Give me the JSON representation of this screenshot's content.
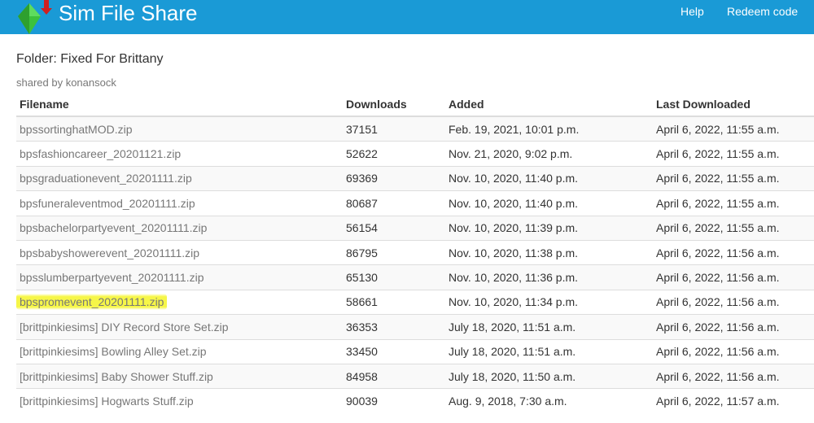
{
  "header": {
    "site_title": "Sim File Share",
    "nav": {
      "help": "Help",
      "redeem": "Redeem code"
    },
    "colors": {
      "bar": "#1a9ad6",
      "plumbob_green": "#3cc23c",
      "arrow_red": "#d02020"
    }
  },
  "folder": {
    "title": "Folder: Fixed For Brittany",
    "shared_by": "shared by konansock"
  },
  "table": {
    "headers": {
      "filename": "Filename",
      "downloads": "Downloads",
      "added": "Added",
      "last_downloaded": "Last Downloaded"
    },
    "rows": [
      {
        "filename": "bpssortinghatMOD.zip",
        "downloads": "37151",
        "added": "Feb. 19, 2021, 10:01 p.m.",
        "last_downloaded": "April 6, 2022, 11:55 a.m."
      },
      {
        "filename": "bpsfashioncareer_20201121.zip",
        "downloads": "52622",
        "added": "Nov. 21, 2020, 9:02 p.m.",
        "last_downloaded": "April 6, 2022, 11:55 a.m."
      },
      {
        "filename": "bpsgraduationevent_20201111.zip",
        "downloads": "69369",
        "added": "Nov. 10, 2020, 11:40 p.m.",
        "last_downloaded": "April 6, 2022, 11:55 a.m."
      },
      {
        "filename": "bpsfuneraleventmod_20201111.zip",
        "downloads": "80687",
        "added": "Nov. 10, 2020, 11:40 p.m.",
        "last_downloaded": "April 6, 2022, 11:55 a.m."
      },
      {
        "filename": "bpsbachelorpartyevent_20201111.zip",
        "downloads": "56154",
        "added": "Nov. 10, 2020, 11:39 p.m.",
        "last_downloaded": "April 6, 2022, 11:55 a.m."
      },
      {
        "filename": "bpsbabyshowerevent_20201111.zip",
        "downloads": "86795",
        "added": "Nov. 10, 2020, 11:38 p.m.",
        "last_downloaded": "April 6, 2022, 11:56 a.m."
      },
      {
        "filename": "bpsslumberpartyevent_20201111.zip",
        "downloads": "65130",
        "added": "Nov. 10, 2020, 11:36 p.m.",
        "last_downloaded": "April 6, 2022, 11:56 a.m."
      },
      {
        "filename": "bpspromevent_20201111.zip",
        "downloads": "58661",
        "added": "Nov. 10, 2020, 11:34 p.m.",
        "last_downloaded": "April 6, 2022, 11:56 a.m.",
        "highlighted": true
      },
      {
        "filename": "[brittpinkiesims] DIY Record Store Set.zip",
        "downloads": "36353",
        "added": "July 18, 2020, 11:51 a.m.",
        "last_downloaded": "April 6, 2022, 11:56 a.m."
      },
      {
        "filename": "[brittpinkiesims] Bowling Alley Set.zip",
        "downloads": "33450",
        "added": "July 18, 2020, 11:51 a.m.",
        "last_downloaded": "April 6, 2022, 11:56 a.m."
      },
      {
        "filename": "[brittpinkiesims] Baby Shower Stuff.zip",
        "downloads": "84958",
        "added": "July 18, 2020, 11:50 a.m.",
        "last_downloaded": "April 6, 2022, 11:56 a.m."
      },
      {
        "filename": "[brittpinkiesims] Hogwarts Stuff.zip",
        "downloads": "90039",
        "added": "Aug. 9, 2018, 7:30 a.m.",
        "last_downloaded": "April 6, 2022, 11:57 a.m."
      }
    ]
  }
}
